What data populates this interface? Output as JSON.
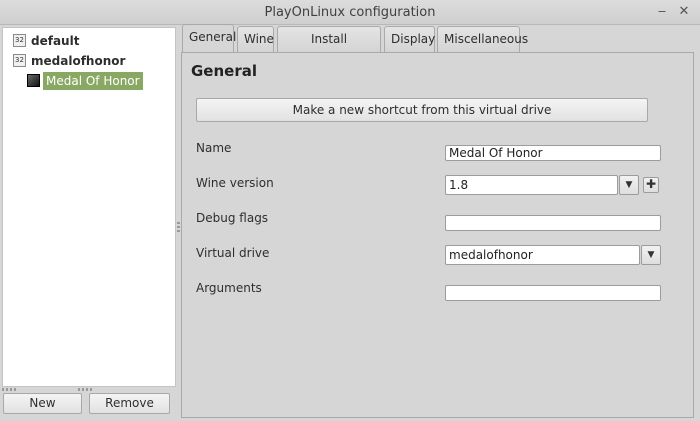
{
  "window": {
    "title": "PlayOnLinux configuration",
    "minimize_glyph": "‒",
    "close_glyph": "✕"
  },
  "sidebar": {
    "items": [
      {
        "badge": "32",
        "label": "default"
      },
      {
        "badge": "32",
        "label": "medalofhonor"
      }
    ],
    "child": {
      "label": "Medal Of Honor"
    },
    "new_label": "New",
    "remove_label": "Remove"
  },
  "tabs": [
    {
      "label": "General"
    },
    {
      "label": "Wine"
    },
    {
      "label": "Install components"
    },
    {
      "label": "Display"
    },
    {
      "label": "Miscellaneous"
    }
  ],
  "general": {
    "title": "General",
    "shortcut_button": "Make a new shortcut from this virtual drive",
    "name_label": "Name",
    "name_value": "Medal Of Honor",
    "wine_label": "Wine version",
    "wine_value": "1.8",
    "debug_label": "Debug flags",
    "debug_value": "",
    "drive_label": "Virtual drive",
    "drive_value": "medalofhonor",
    "args_label": "Arguments",
    "args_value": "",
    "dropdown_glyph": "▼",
    "add_glyph": "✚"
  },
  "icons": {
    "badge": "32-bit-prefix-icon",
    "game": "game-icon",
    "dropdown": "chevron-down-icon",
    "add": "plus-icon"
  }
}
